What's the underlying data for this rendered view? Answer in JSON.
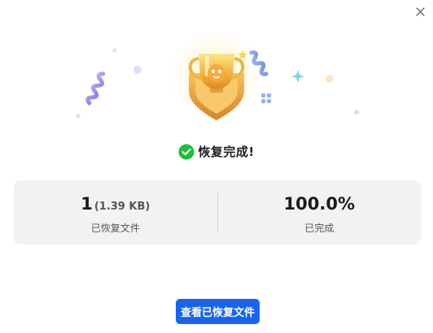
{
  "dialog": {
    "close_icon": "close-icon"
  },
  "hero": {
    "icon": "trophy-badge-icon",
    "decorations": [
      "confetti-streamer-icon",
      "sparkle-icon",
      "star-icon",
      "clover-icon",
      "dot-icon"
    ]
  },
  "status": {
    "icon": "check-circle-icon",
    "text": "恢复完成!",
    "color": "#19c03c"
  },
  "stats": {
    "recovered": {
      "count": "1",
      "size": "(1.39 KB)",
      "label": "已恢复文件"
    },
    "progress": {
      "value": "100.0%",
      "label": "已完成"
    }
  },
  "actions": {
    "view_button_label": "查看已恢复文件",
    "accent": "#1565f0"
  }
}
